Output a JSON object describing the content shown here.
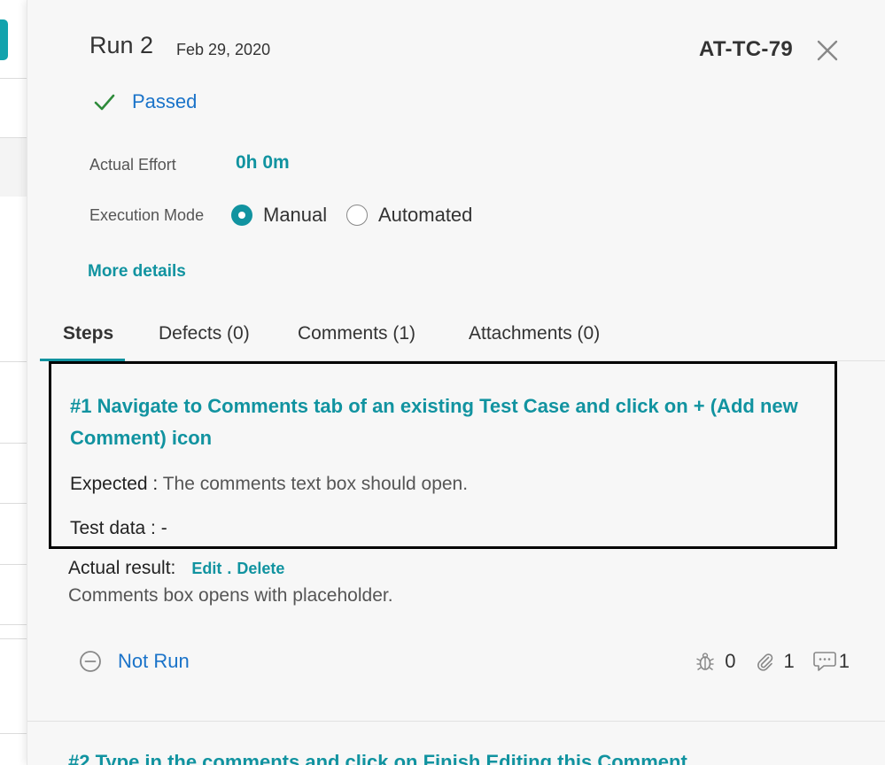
{
  "header": {
    "run_title": "Run 2",
    "run_date": "Feb 29, 2020",
    "test_case_id": "AT-TC-79"
  },
  "status": {
    "label": "Passed",
    "color": "#1a73c9",
    "icon": "check-icon"
  },
  "effort": {
    "label": "Actual Effort",
    "value": "0h 0m"
  },
  "execution_mode": {
    "label": "Execution Mode",
    "options": [
      {
        "label": "Manual",
        "selected": true
      },
      {
        "label": "Automated",
        "selected": false
      }
    ]
  },
  "more_details_label": "More details",
  "tabs": [
    {
      "label": "Steps",
      "active": true
    },
    {
      "label": "Defects (0)",
      "active": false
    },
    {
      "label": "Comments (1)",
      "active": false
    },
    {
      "label": "Attachments (0)",
      "active": false
    }
  ],
  "step1": {
    "title": "#1 Navigate to Comments tab of an existing Test Case and click on + (Add new Comment) icon",
    "expected_label": "Expected :",
    "expected_value": "The comments text box should open.",
    "test_data_label": "Test data :",
    "test_data_value": "-",
    "actual_result_label": "Actual result:",
    "edit_label": "Edit",
    "separator": ".",
    "delete_label": "Delete",
    "actual_result_text": "Comments box opens with placeholder.",
    "status_label": "Not Run",
    "defects_count": "0",
    "attachments_count": "1",
    "comments_count": "1"
  },
  "step2": {
    "title": "#2 Type in the comments and click on Finish Editing this Comment"
  },
  "colors": {
    "accent": "#1193a0",
    "link_blue": "#1a73c9",
    "success": "#2e8b3a"
  }
}
